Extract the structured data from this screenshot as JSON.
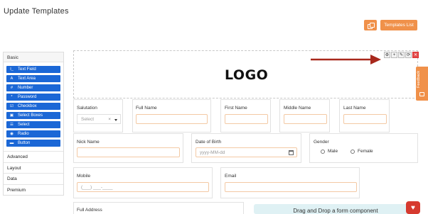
{
  "page": {
    "title": "Update Templates"
  },
  "toolbar": {
    "copy_icon": "copy-icon",
    "templates_list_label": "Templates List",
    "accent": "#f0914a"
  },
  "sidebar": {
    "basic_label": "Basic",
    "fields": [
      {
        "icon": "I_",
        "label": "Text Field"
      },
      {
        "icon": "A",
        "label": "Text Area"
      },
      {
        "icon": "#",
        "label": "Number"
      },
      {
        "icon": "*",
        "label": "Password"
      },
      {
        "icon": "☑",
        "label": "Checkbox"
      },
      {
        "icon": "▣",
        "label": "Select Boxes"
      },
      {
        "icon": "☰",
        "label": "Select"
      },
      {
        "icon": "◉",
        "label": "Radio"
      },
      {
        "icon": "▬",
        "label": "Button"
      }
    ],
    "sections": [
      "Advanced",
      "Layout",
      "Data",
      "Premium"
    ],
    "button_color": "#1b67d6"
  },
  "canvas": {
    "logo_text": "LOGO",
    "tool_icons": [
      "gear-icon",
      "plus-icon",
      "wrench-icon",
      "refresh-icon",
      "delete-icon"
    ],
    "tool_glyphs": [
      "⚙",
      "+",
      "✎",
      "⟳",
      "✕"
    ],
    "salutation": {
      "label": "Salutation",
      "placeholder": "Select",
      "clear": "×"
    },
    "full_name": {
      "label": "Full Name"
    },
    "first_name": {
      "label": "First Name"
    },
    "middle_name": {
      "label": "Middle Name"
    },
    "last_name": {
      "label": "Last Name"
    },
    "nick_name": {
      "label": "Nick Name"
    },
    "dob": {
      "label": "Date of Birth",
      "placeholder": "yyyy-MM-dd"
    },
    "gender": {
      "label": "Gender",
      "options": [
        "Male",
        "Female"
      ]
    },
    "mobile": {
      "label": "Mobile",
      "placeholder": "(___) ___-____"
    },
    "email": {
      "label": "Email"
    },
    "full_address": {
      "label": "Full Address"
    },
    "drop_hint": "Drag and Drop a form component"
  },
  "feedback": {
    "label": "Feedback"
  }
}
